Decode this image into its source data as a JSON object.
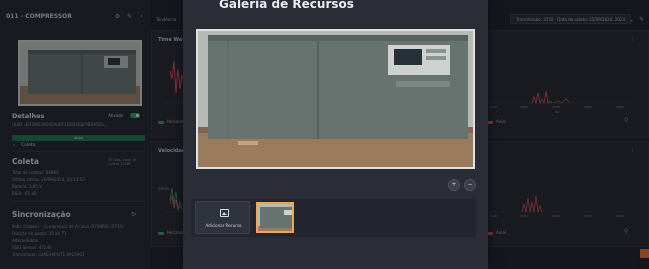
{
  "left_panel": {
    "title": "011 - COMPRESSOR",
    "details": {
      "title": "Detalhes",
      "status": "Ativado",
      "id": "UUID: 3EF89D20D05A0DF1D0D5E8F9B6A5D1..."
    },
    "green_bar": "Ativo",
    "tab": "Coleta",
    "coleta": {
      "title": "Coleta",
      "right_text": "35 dias, Hoje 16 Coleta 12/08",
      "lines": [
        "Total de coletas: 64983",
        "Última coleta: 26/09/2024, 20:13:53",
        "Bateria: 3,85 V",
        "RSSI: -65 dB"
      ]
    },
    "sync": {
      "title": "Sincronização",
      "lines": [
        "Path: Fazbens - Compressor de Ar alvo (9788PD) (0735)",
        "Posição no ponto: 35 de 71",
        "Alterar/Editar",
        "SSID Sensor: 47246",
        "Transmissor: LUKE/HIPSITE 8A25001"
      ]
    }
  },
  "dashboard": {
    "top_label": "Tendência",
    "date_pill": "Transmissão: 3550 · Data da coleta: 25/09/2024, 2024",
    "card1_title": "Time Waveform",
    "card2_title": "Velocidade",
    "legend_green": "Horizontal",
    "legend_red": "Axial",
    "y_label": "mm/s",
    "x_ticks": [
      "0.00",
      "1000",
      "2000",
      "3000",
      "4000"
    ],
    "x_unit": "Hz"
  },
  "modal": {
    "title": "Galeria de Recursos",
    "zoom_in": "+",
    "zoom_out": "−",
    "add_resource_label": "Adicionar Recurso"
  },
  "colors": {
    "accent_green": "#2fa36b",
    "accent_orange": "#e9772e",
    "series_red": "#e0535e"
  }
}
